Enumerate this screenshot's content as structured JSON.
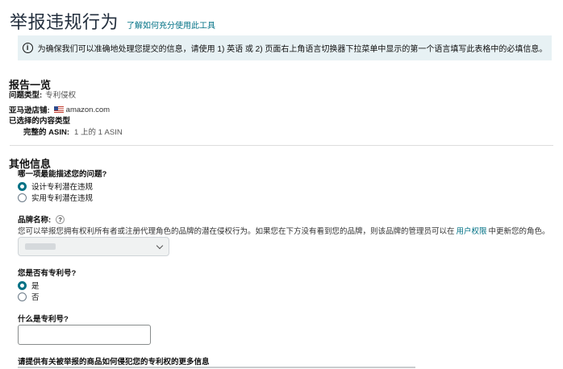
{
  "header": {
    "title": "举报违规行为",
    "learn_link": "了解如何充分使用此工具"
  },
  "notice": {
    "icon": "info-icon",
    "text": "为确保我们可以准确地处理您提交的信息，请使用 1) 英语 或 2) 页面右上角语言切换器下拉菜单中显示的第一个语言填写此表格中的必填信息。"
  },
  "summary": {
    "heading": "报告一览",
    "issue_type_label": "问题类型:",
    "issue_type_value": "专利侵权",
    "store_label": "亚马逊店铺:",
    "store_flag": "us-flag-icon",
    "store_value": "amazon.com",
    "content_type_label": "已选择的内容类型",
    "asin_label": "完整的 ASIN:",
    "asin_value": "1 上的 1 ASIN"
  },
  "other_info": {
    "heading": "其他信息",
    "question1": "哪一项最能描述您的问题?",
    "q1_options": [
      {
        "label": "设计专利潜在违规",
        "selected": true
      },
      {
        "label": "实用专利潜在违规",
        "selected": false
      }
    ],
    "brand_label": "品牌名称:",
    "brand_help": "?",
    "brand_desc_before": "您可以举报您拥有权利所有者或注册代理角色的品牌的潜在侵权行为。如果您在下方没有看到您的品牌，则该品牌的管理员可以在",
    "brand_desc_link": "用户权限",
    "brand_desc_after": "中更新您的角色。",
    "question2": "您是否有专利号?",
    "q2_options": [
      {
        "label": "是",
        "selected": true
      },
      {
        "label": "否",
        "selected": false
      }
    ],
    "question3": "什么是专利号?",
    "question4": "请提供有关被举报的商品如何侵犯您的专利权的更多信息"
  }
}
